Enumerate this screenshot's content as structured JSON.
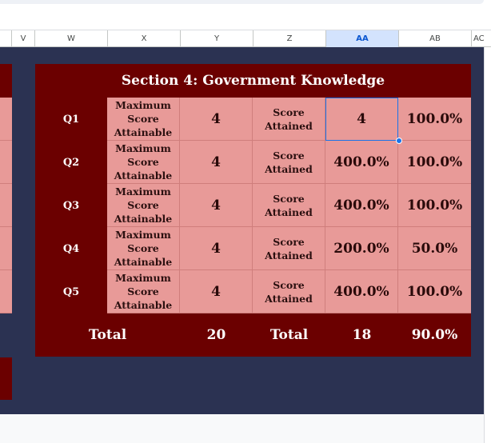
{
  "columns": [
    "V",
    "W",
    "X",
    "Y",
    "Z",
    "AA",
    "AB",
    "AC"
  ],
  "selected_column": "AA",
  "section": {
    "title": "Section 4: Government Knowledge",
    "rows": [
      {
        "q": "Q1",
        "max_label": "Maximum Score Attainable",
        "max": "4",
        "attained_label": "Score Attained",
        "attained": "4",
        "pct": "100.0%"
      },
      {
        "q": "Q2",
        "max_label": "Maximum Score Attainable",
        "max": "4",
        "attained_label": "Score Attained",
        "attained": "400.0%",
        "pct": "100.0%"
      },
      {
        "q": "Q3",
        "max_label": "Maximum Score Attainable",
        "max": "4",
        "attained_label": "Score Attained",
        "attained": "400.0%",
        "pct": "100.0%"
      },
      {
        "q": "Q4",
        "max_label": "Maximum Score Attainable",
        "max": "4",
        "attained_label": "Score Attained",
        "attained": "200.0%",
        "pct": "50.0%"
      },
      {
        "q": "Q5",
        "max_label": "Maximum Score Attainable",
        "max": "4",
        "attained_label": "Score Attained",
        "attained": "400.0%",
        "pct": "100.0%"
      }
    ],
    "totals": {
      "label_max": "Total",
      "max": "20",
      "label_attained": "Total",
      "attained": "18",
      "pct": "90.0%"
    }
  },
  "colors": {
    "header_fill": "#6b0000",
    "cell_fill": "#e89a98",
    "background": "#2b3252",
    "selection": "#1a73e8"
  }
}
